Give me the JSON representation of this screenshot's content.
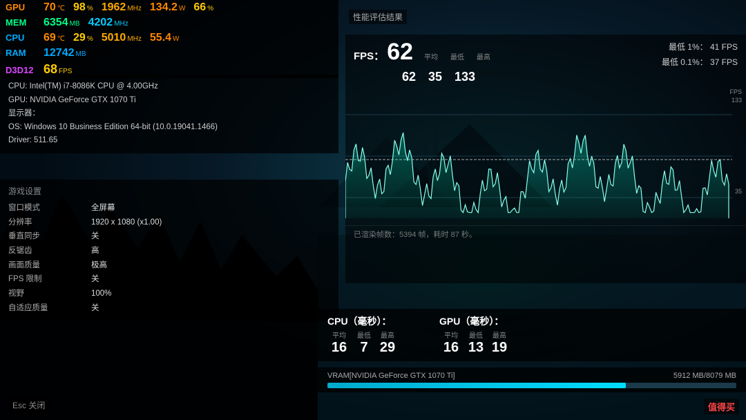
{
  "bg": {
    "description": "dark teal game scene background"
  },
  "hud": {
    "metrics_row1": {
      "gpu_label": "GPU",
      "gpu_temp": "70",
      "gpu_temp_unit": "℃",
      "gpu_usage": "98",
      "gpu_usage_unit": "%",
      "gpu_clock": "1962",
      "gpu_clock_unit": "MHz",
      "gpu_power": "134.2",
      "gpu_power_unit": "W",
      "gpu_load2": "66",
      "gpu_load2_unit": "%"
    },
    "metrics_row2": {
      "mem_label": "MEM",
      "mem_usage": "6354",
      "mem_usage_unit": "MB",
      "mem_clock": "4202",
      "mem_clock_unit": "MHz",
      "perf_label": "性能评估结果"
    },
    "metrics_row3": {
      "cpu_label": "CPU",
      "cpu_temp": "69",
      "cpu_temp_unit": "℃",
      "cpu_usage": "29",
      "cpu_usage_unit": "%",
      "cpu_clock": "5010",
      "cpu_clock_unit": "MHz",
      "cpu_power": "55.4",
      "cpu_power_unit": "W"
    },
    "metrics_row4": {
      "ram_label": "RAM",
      "ram_usage": "12742",
      "ram_usage_unit": "MB"
    },
    "metrics_row5": {
      "d3d_label": "D3D12",
      "fps_val": "68",
      "fps_unit": "FPS"
    }
  },
  "system_info": {
    "cpu_line": "CPU: Intel(TM) i7-8086K CPU @ 4.00GHz",
    "gpu_line": "GPU: NVIDIA GeForce GTX 1070 Ti",
    "display_label": "显示器：",
    "os_line": "OS: Windows 10 Business Edition 64-bit (10.0.19041.1466)",
    "driver_line": "Driver: 511.65"
  },
  "game_settings": {
    "title": "游戏设置",
    "rows": [
      {
        "key": "窗口模式",
        "val": "全屏幕"
      },
      {
        "key": "分辨率",
        "val": "1920 x 1080 (x1.00)"
      },
      {
        "key": "垂直同步",
        "val": "关"
      },
      {
        "key": "反锯齿",
        "val": "高"
      },
      {
        "key": "画面质量",
        "val": "极高"
      },
      {
        "key": "FPS 限制",
        "val": "关"
      },
      {
        "key": "视野",
        "val": "100%"
      },
      {
        "key": "自适应质量",
        "val": "关"
      }
    ]
  },
  "fps_chart": {
    "fps_label": "FPS：",
    "fps_avg": "62",
    "fps_min": "35",
    "fps_max": "133",
    "col_avg": "平均",
    "col_min": "最低",
    "col_max": "最高",
    "percentile_1": "最低 1%：  41 FPS",
    "percentile_01": "最低 0.1%：  37 FPS",
    "y_top": "FPS",
    "y_top_val": "133",
    "y_bottom_val": "35",
    "caption": "已渲染帧数：5394 帧，耗时 87 秒。"
  },
  "bottom_stats": {
    "cpu_label": "CPU（毫秒）：",
    "cpu_avg": "16",
    "cpu_min": "7",
    "cpu_max": "29",
    "gpu_label": "GPU（毫秒）：",
    "gpu_avg": "16",
    "gpu_min": "13",
    "gpu_max": "19",
    "col_avg": "平均",
    "col_min": "最低",
    "col_max": "最高"
  },
  "vram": {
    "label": "VRAM[NVIDIA GeForce GTX 1070 Ti]",
    "used": "5912",
    "total": "8079",
    "unit": "MB",
    "fill_pct": 73
  },
  "footer": {
    "esc_label": "Esc 关闭",
    "watermark": "值得买"
  }
}
